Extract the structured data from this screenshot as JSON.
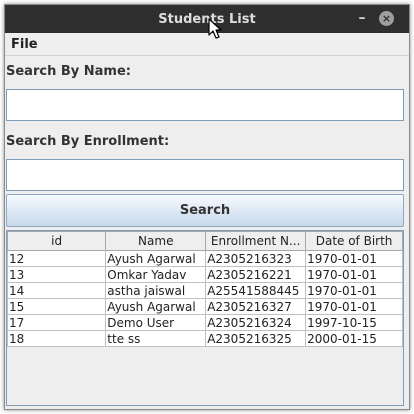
{
  "window": {
    "title": "Students List"
  },
  "menu": {
    "file": "File"
  },
  "search_by_name": {
    "label": "Search By Name:",
    "value": ""
  },
  "search_by_enrollment": {
    "label": "Search By Enrollment:",
    "value": ""
  },
  "search_button": {
    "label": "Search"
  },
  "table": {
    "columns": [
      "id",
      "Name",
      "Enrollment N...",
      "Date of Birth"
    ],
    "rows": [
      [
        "12",
        "Ayush Agarwal",
        "A2305216323",
        "1970-01-01"
      ],
      [
        "13",
        "Omkar Yadav",
        "A2305216221",
        "1970-01-01"
      ],
      [
        "14",
        "astha jaiswal",
        "A25541588445",
        "1970-01-01"
      ],
      [
        "15",
        "Ayush Agarwal",
        "A2305216327",
        "1970-01-01"
      ],
      [
        "17",
        "Demo User",
        "A2305216324",
        "1997-10-15"
      ],
      [
        "18",
        "tte ss",
        "A2305216325",
        "2000-01-15"
      ]
    ]
  },
  "icons": {
    "minimize": "minimize-icon",
    "close": "close-icon",
    "cursor": "mouse-pointer-icon"
  }
}
